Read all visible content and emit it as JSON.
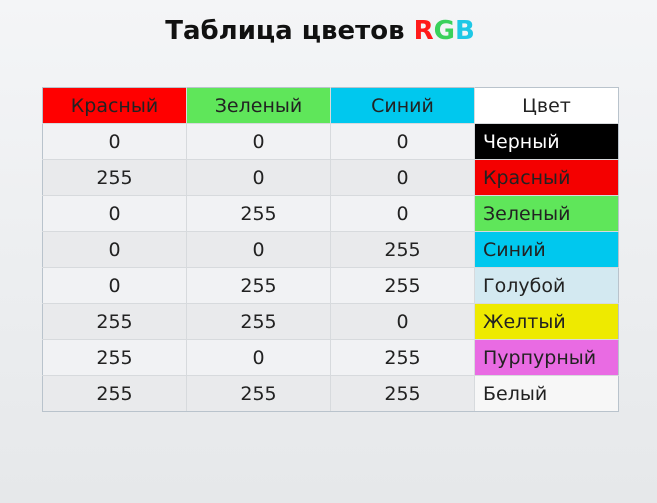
{
  "title": {
    "text": "Таблица цветов ",
    "letter_r": "R",
    "letter_g": "G",
    "letter_b": "B"
  },
  "table": {
    "headers": [
      {
        "label": "Красный",
        "bg": "#ff0000",
        "fg": "#222222"
      },
      {
        "label": "Зеленый",
        "bg": "#5fe65a",
        "fg": "#222222"
      },
      {
        "label": "Синий",
        "bg": "#00c8ee",
        "fg": "#222222"
      },
      {
        "label": "Цвет",
        "bg": "#ffffff",
        "fg": "#222222"
      }
    ],
    "rows": [
      {
        "r": "0",
        "g": "0",
        "b": "0",
        "name": "Черный",
        "bg": "#000000",
        "fg": "#ffffff"
      },
      {
        "r": "255",
        "g": "0",
        "b": "0",
        "name": "Красный",
        "bg": "#f40000",
        "fg": "#222222"
      },
      {
        "r": "0",
        "g": "255",
        "b": "0",
        "name": "Зеленый",
        "bg": "#5fe65a",
        "fg": "#222222"
      },
      {
        "r": "0",
        "g": "0",
        "b": "255",
        "name": "Синий",
        "bg": "#00c8ee",
        "fg": "#222222"
      },
      {
        "r": "0",
        "g": "255",
        "b": "255",
        "name": "Голубой",
        "bg": "#d3e9f1",
        "fg": "#222222"
      },
      {
        "r": "255",
        "g": "255",
        "b": "0",
        "name": "Желтый",
        "bg": "#eeea00",
        "fg": "#222222"
      },
      {
        "r": "255",
        "g": "0",
        "b": "255",
        "name": "Пурпурный",
        "bg": "#e96be3",
        "fg": "#222222"
      },
      {
        "r": "255",
        "g": "255",
        "b": "255",
        "name": "Белый",
        "bg": "#f7f7f7",
        "fg": "#222222"
      }
    ]
  }
}
